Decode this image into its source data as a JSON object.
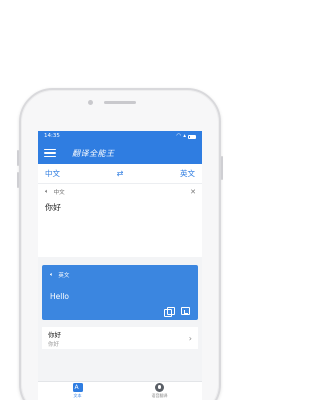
{
  "status": {
    "time": "14:35"
  },
  "app": {
    "title": "翻译全能王"
  },
  "languages": {
    "source": "中文",
    "target": "英文"
  },
  "input": {
    "lang_label": "中文",
    "text": "你好"
  },
  "result": {
    "lang_label": "英文",
    "text": "Hello"
  },
  "history": {
    "source": "你好",
    "translation": "你好"
  },
  "bottom_nav": {
    "items": [
      {
        "label": "文本"
      },
      {
        "label": "语音翻译"
      }
    ]
  },
  "colors": {
    "primary": "#2f7de1",
    "result_card": "#3b86e0"
  }
}
